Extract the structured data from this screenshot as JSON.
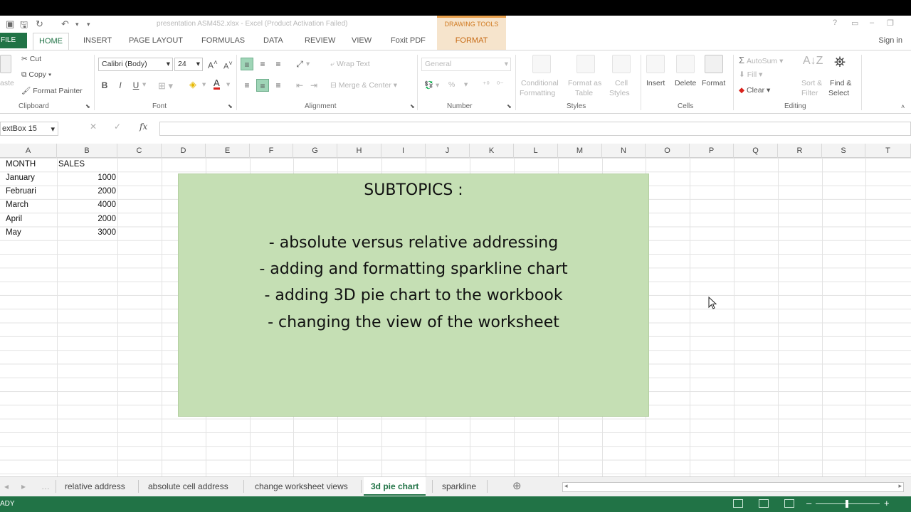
{
  "window": {
    "title": "presentation ASM452.xlsx - Excel (Product Activation Failed)",
    "context_tab_group": "DRAWING TOOLS",
    "signin_label": "Sign in"
  },
  "tabs": {
    "file": "FILE",
    "home": "HOME",
    "insert": "INSERT",
    "page_layout": "PAGE LAYOUT",
    "formulas": "FORMULAS",
    "data": "DATA",
    "review": "REVIEW",
    "view": "VIEW",
    "foxit": "Foxit PDF",
    "format": "FORMAT"
  },
  "ribbon": {
    "clipboard": {
      "label": "Clipboard",
      "paste": "aste",
      "cut": "Cut",
      "copy": "Copy",
      "format_painter": "Format Painter"
    },
    "font": {
      "label": "Font",
      "font_name": "Calibri (Body)",
      "font_size": "24",
      "bold": "B",
      "italic": "I",
      "underline": "U"
    },
    "alignment": {
      "label": "Alignment",
      "wrap_text": "Wrap Text",
      "merge_center": "Merge & Center"
    },
    "number": {
      "label": "Number",
      "format": "General",
      "percent": "%"
    },
    "styles": {
      "label": "Styles",
      "conditional_formatting_1": "Conditional",
      "conditional_formatting_2": "Formatting",
      "format_as_table_1": "Format as",
      "format_as_table_2": "Table",
      "cell_styles_1": "Cell",
      "cell_styles_2": "Styles"
    },
    "cells": {
      "label": "Cells",
      "insert": "Insert",
      "delete": "Delete",
      "format": "Format"
    },
    "editing": {
      "label": "Editing",
      "autosum": "AutoSum",
      "fill": "Fill",
      "clear": "Clear",
      "sort_filter_1": "Sort &",
      "sort_filter_2": "Filter",
      "find_select_1": "Find &",
      "find_select_2": "Select"
    }
  },
  "formula_bar": {
    "name_box": "extBox 15",
    "fx": "fx",
    "value": ""
  },
  "columns": [
    "A",
    "B",
    "C",
    "D",
    "E",
    "F",
    "G",
    "H",
    "I",
    "J",
    "K",
    "L",
    "M",
    "N",
    "O",
    "P",
    "Q",
    "R",
    "S",
    "T"
  ],
  "table": {
    "headers": [
      "MONTH",
      "SALES"
    ],
    "rows": [
      {
        "month": "January",
        "sales": "1000"
      },
      {
        "month": "Februari",
        "sales": "2000"
      },
      {
        "month": "March",
        "sales": "4000"
      },
      {
        "month": "April",
        "sales": "2000"
      },
      {
        "month": "May",
        "sales": "3000"
      }
    ]
  },
  "textbox": {
    "title": "SUBTOPICS :",
    "lines": [
      "- absolute versus relative addressing",
      "- adding and formatting sparkline chart",
      "- adding 3D pie chart to the workbook",
      "- changing the view of the worksheet"
    ],
    "fill_color": "#c5dfb4"
  },
  "sheet_tabs": [
    "relative address",
    "absolute cell address",
    "change worksheet views",
    "3d pie chart",
    "sparkline"
  ],
  "active_sheet": "3d pie chart",
  "status": {
    "text": "ADY"
  },
  "colors": {
    "accent": "#217346",
    "context_tab": "#f6e4cc"
  }
}
